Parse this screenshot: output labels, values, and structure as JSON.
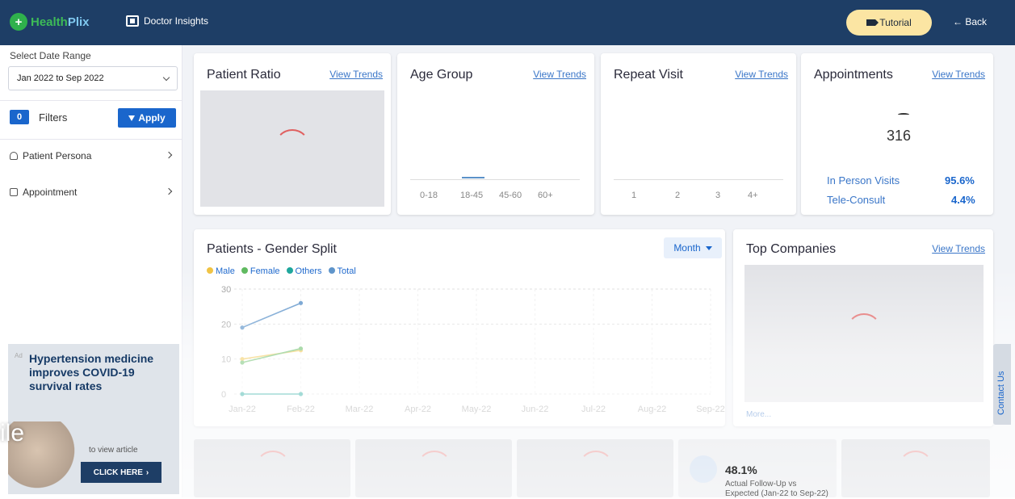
{
  "header": {
    "logo_part1": "Health",
    "logo_part2": "Plix",
    "section": "Doctor Insights",
    "tutorial_label": "Tutorial",
    "back_label": "Back"
  },
  "sidebar": {
    "date_range_label": "Select Date Range",
    "date_range_value": "Jan 2022 to Sep 2022",
    "filter_count": "0",
    "filters_label": "Filters",
    "apply_label": "Apply",
    "items": [
      {
        "label": "Patient Persona"
      },
      {
        "label": "Appointment"
      }
    ]
  },
  "cards": {
    "patient_ratio": {
      "title": "Patient Ratio",
      "link": "View Trends"
    },
    "age_group": {
      "title": "Age Group",
      "link": "View Trends",
      "ticks": [
        "0-18",
        "18-45",
        "45-60",
        "60+"
      ]
    },
    "repeat_visit": {
      "title": "Repeat Visit",
      "link": "View Trends",
      "ticks": [
        "1",
        "2",
        "3",
        "4+"
      ]
    },
    "appointments": {
      "title": "Appointments",
      "link": "View Trends",
      "total": "316",
      "in_person_label": "In Person Visits",
      "in_person_value": "95.6%",
      "tele_label": "Tele-Consult",
      "tele_value": "4.4%"
    },
    "gender_split": {
      "title": "Patients - Gender Split",
      "period": "Month"
    },
    "top_companies": {
      "title": "Top Companies",
      "link": "View Trends",
      "more": "More..."
    },
    "followup": {
      "value": "48.1%",
      "text": "Actual Follow-Up vs Expected (Jan-22 to Sep-22)"
    }
  },
  "chart_data": {
    "type": "line",
    "categories": [
      "Jan-22",
      "Feb-22",
      "Mar-22",
      "Apr-22",
      "May-22",
      "Jun-22",
      "Jul-22",
      "Aug-22",
      "Sep-22"
    ],
    "series": [
      {
        "name": "Male",
        "color": "#f0c240",
        "values": [
          10,
          12.5
        ]
      },
      {
        "name": "Female",
        "color": "#5cb85c",
        "values": [
          9,
          13
        ]
      },
      {
        "name": "Others",
        "color": "#1aa59a",
        "values": [
          0,
          0
        ]
      },
      {
        "name": "Total",
        "color": "#5b92c9",
        "values": [
          19,
          26
        ]
      }
    ],
    "yticks": [
      "0",
      "10",
      "20",
      "30"
    ],
    "ylim": [
      0,
      30
    ]
  },
  "ad": {
    "tag": "Ad",
    "headline": "Hypertension medicine improves COVID-19 survival rates",
    "sub": "to view article",
    "cta": "CLICK HERE",
    "overflow_text": "ile"
  },
  "contact": "Contact Us"
}
